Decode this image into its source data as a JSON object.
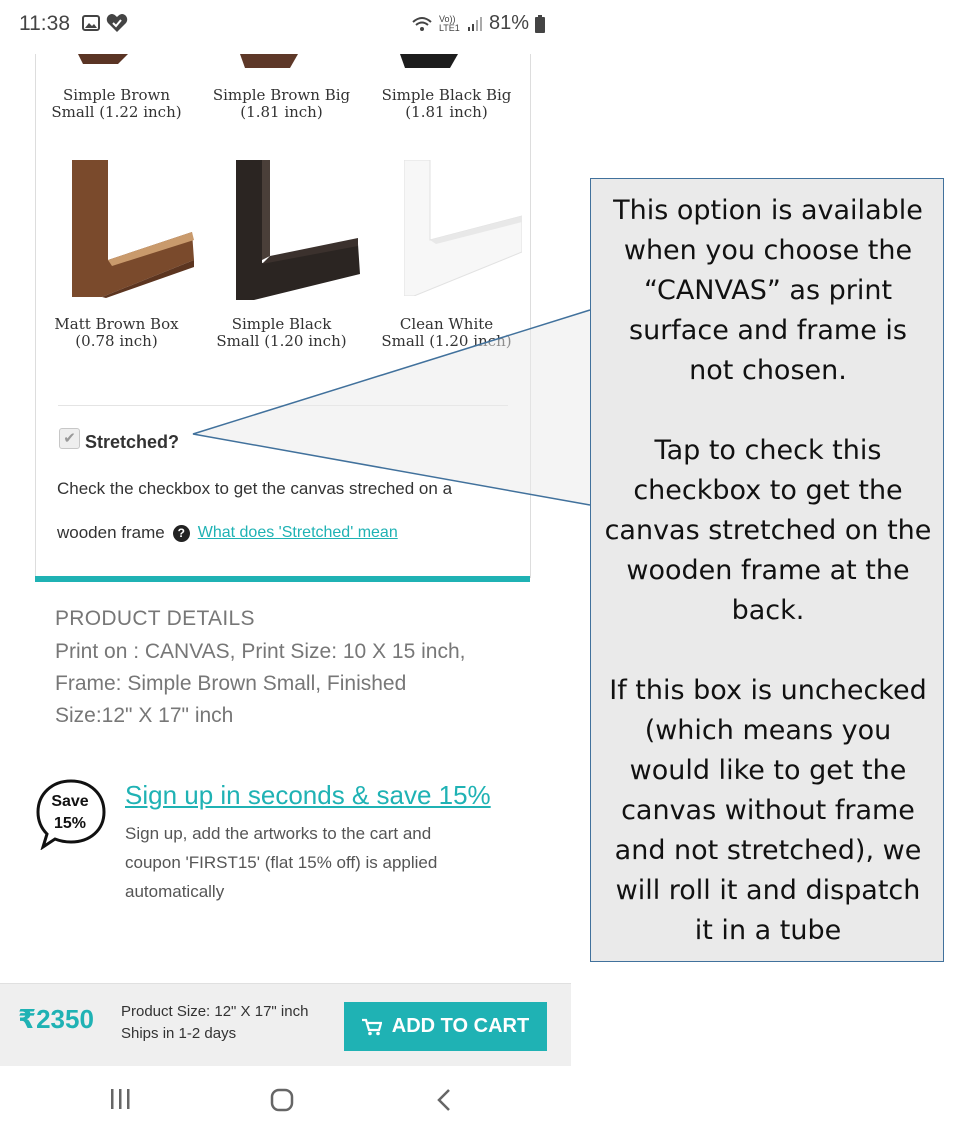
{
  "status_bar": {
    "time": "11:38",
    "network_label": "Vo)) LTE1",
    "battery": "81%",
    "icons_left": [
      "gallery-icon",
      "heart-check-icon"
    ],
    "icons_right": [
      "wifi-calling-icon",
      "signal-icon",
      "battery-icon"
    ]
  },
  "frames_top_row": [
    {
      "name": "Simple Brown",
      "size": "Small (1.22 inch)"
    },
    {
      "name": "Simple Brown Big",
      "size": "(1.81 inch)"
    },
    {
      "name": "Simple Black Big",
      "size": "(1.81 inch)"
    }
  ],
  "frames_second_row": [
    {
      "name": "Matt Brown Box",
      "size": "(0.78 inch)",
      "color": "#7a4a2c"
    },
    {
      "name": "Simple Black",
      "size": "Small (1.20 inch)",
      "color": "#2b2522"
    },
    {
      "name": "Clean White",
      "size": "Small (1.20 inch)",
      "color": "#f4f4f4"
    }
  ],
  "stretched": {
    "label": "Stretched?",
    "checked": true,
    "help_line1": "Check the checkbox to get the canvas streched on a",
    "help_line2": "wooden frame",
    "link": "What does 'Stretched' mean"
  },
  "product_details": {
    "title": "PRODUCT DETAILS",
    "lines": [
      "Print on : CANVAS, Print Size: 10 X 15 inch,",
      "Frame: Simple Brown Small, Finished",
      "Size:12\" X 17\" inch"
    ]
  },
  "promo": {
    "badge_line1": "Save",
    "badge_line2": "15%",
    "heading": "Sign up in seconds & save 15%",
    "lines": [
      "Sign up, add the artworks to the cart and",
      "coupon 'FIRST15' (flat 15% off) is applied",
      "automatically"
    ]
  },
  "bottom_bar": {
    "price": "₹2350",
    "product_size": "Product Size: 12\" X 17\" inch",
    "ships": "Ships in 1-2 days",
    "cart_button": "ADD TO CART"
  },
  "callout": {
    "paragraph1": [
      "This option is available",
      "when you choose the",
      "“CANVAS” as print",
      "surface and frame is",
      "not chosen."
    ],
    "paragraph2": [
      "Tap to check this",
      "checkbox to get the",
      "canvas stretched on the",
      "wooden frame at the",
      "back."
    ],
    "paragraph3": [
      "If this box is unchecked",
      "(which means you",
      "would like to get the",
      "canvas without frame",
      "and not stretched), we",
      "will roll it and dispatch",
      "it in a tube"
    ]
  },
  "colors": {
    "accent": "#1fb2b4",
    "callout_border": "#41719c",
    "callout_fill": "#eaeaea"
  }
}
